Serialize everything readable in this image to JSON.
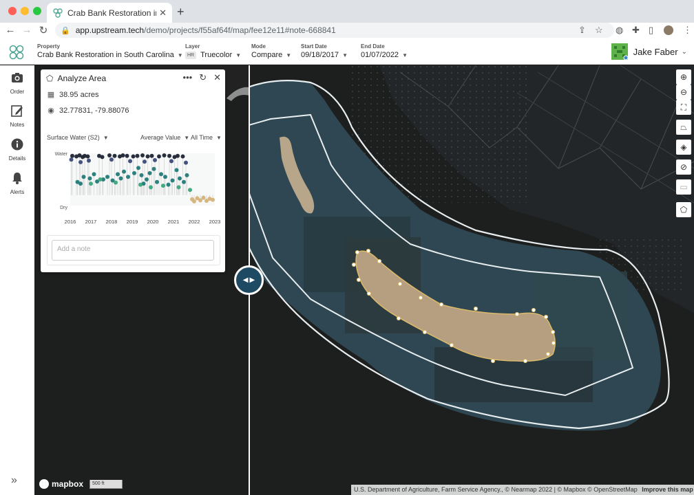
{
  "browser": {
    "tab_title": "Crab Bank Restoration in South",
    "url_host": "app.upstream.tech",
    "url_path": "/demo/projects/f55af64f/map/fee12e11#note-668841"
  },
  "header": {
    "property_label": "Property",
    "property_value": "Crab Bank Restoration in South Carolina",
    "layer_label": "Layer",
    "layer_badge": "HR",
    "layer_value": "Truecolor",
    "mode_label": "Mode",
    "mode_value": "Compare",
    "start_label": "Start Date",
    "start_value": "09/18/2017",
    "end_label": "End Date",
    "end_value": "01/07/2022",
    "user_name": "Jake Faber"
  },
  "rail": {
    "items": [
      {
        "label": "Order",
        "icon": "camera-icon"
      },
      {
        "label": "Notes",
        "icon": "edit-icon"
      },
      {
        "label": "Details",
        "icon": "info-icon"
      },
      {
        "label": "Alerts",
        "icon": "bell-icon"
      }
    ]
  },
  "panel": {
    "title": "Analyze Area",
    "area": "38.95 acres",
    "coords": "32.77831, -79.88076",
    "metric": "Surface Water (S2)",
    "aggregation": "Average Value",
    "range": "All Time",
    "note_placeholder": "Add a note"
  },
  "chart_data": {
    "type": "scatter",
    "title": "",
    "xlabel": "",
    "ylabel": "",
    "y_top_label": "Water",
    "y_bottom_label": "Dry",
    "x_ticks": [
      "2016",
      "2017",
      "2018",
      "2019",
      "2020",
      "2021",
      "2022",
      "2023"
    ],
    "xlim": [
      2016,
      2023
    ],
    "ylim": [
      0,
      1
    ],
    "series": [
      {
        "color": "#1f2433",
        "points": [
          [
            2016.1,
            0.95
          ],
          [
            2016.3,
            0.94
          ],
          [
            2016.45,
            0.96
          ],
          [
            2016.6,
            0.93
          ],
          [
            2016.7,
            0.95
          ],
          [
            2016.85,
            0.94
          ],
          [
            2017.4,
            0.95
          ],
          [
            2017.55,
            0.93
          ],
          [
            2017.9,
            0.96
          ],
          [
            2018.15,
            0.95
          ],
          [
            2018.4,
            0.94
          ],
          [
            2018.55,
            0.96
          ],
          [
            2018.75,
            0.95
          ],
          [
            2019.05,
            0.94
          ],
          [
            2019.25,
            0.95
          ],
          [
            2019.5,
            0.96
          ],
          [
            2019.75,
            0.94
          ],
          [
            2019.95,
            0.95
          ],
          [
            2020.3,
            0.94
          ],
          [
            2020.55,
            0.96
          ],
          [
            2020.8,
            0.95
          ],
          [
            2021.05,
            0.93
          ],
          [
            2021.2,
            0.95
          ],
          [
            2021.45,
            0.94
          ]
        ]
      },
      {
        "color": "#3b4a7a",
        "points": [
          [
            2016.05,
            0.88
          ],
          [
            2016.5,
            0.83
          ],
          [
            2016.9,
            0.86
          ],
          [
            2018.0,
            0.88
          ],
          [
            2018.9,
            0.85
          ],
          [
            2019.6,
            0.84
          ],
          [
            2020.1,
            0.87
          ],
          [
            2020.9,
            0.85
          ],
          [
            2021.6,
            0.82
          ]
        ]
      },
      {
        "color": "#227a78",
        "points": [
          [
            2016.35,
            0.45
          ],
          [
            2016.5,
            0.42
          ],
          [
            2016.65,
            0.55
          ],
          [
            2016.95,
            0.52
          ],
          [
            2017.15,
            0.6
          ],
          [
            2017.3,
            0.46
          ],
          [
            2017.6,
            0.5
          ],
          [
            2017.8,
            0.55
          ],
          [
            2018.05,
            0.48
          ],
          [
            2018.3,
            0.6
          ],
          [
            2018.45,
            0.52
          ],
          [
            2018.6,
            0.65
          ],
          [
            2018.8,
            0.55
          ],
          [
            2019.1,
            0.62
          ],
          [
            2019.3,
            0.72
          ],
          [
            2019.45,
            0.58
          ],
          [
            2019.55,
            0.42
          ],
          [
            2019.7,
            0.5
          ],
          [
            2019.85,
            0.62
          ],
          [
            2020.05,
            0.7
          ],
          [
            2020.2,
            0.45
          ],
          [
            2020.4,
            0.6
          ],
          [
            2020.6,
            0.55
          ],
          [
            2020.75,
            0.4
          ],
          [
            2020.95,
            0.48
          ],
          [
            2021.15,
            0.68
          ],
          [
            2021.3,
            0.52
          ],
          [
            2021.5,
            0.45
          ],
          [
            2021.65,
            0.58
          ]
        ]
      },
      {
        "color": "#39a77a",
        "points": [
          [
            2017.0,
            0.42
          ],
          [
            2017.45,
            0.5
          ],
          [
            2018.2,
            0.44
          ],
          [
            2019.4,
            0.4
          ],
          [
            2019.9,
            0.35
          ],
          [
            2020.5,
            0.38
          ],
          [
            2021.25,
            0.35
          ],
          [
            2021.8,
            0.3
          ]
        ]
      },
      {
        "color": "#d4b37a",
        "points": [
          [
            2021.9,
            0.12
          ],
          [
            2022.0,
            0.08
          ],
          [
            2022.15,
            0.14
          ],
          [
            2022.3,
            0.1
          ],
          [
            2022.45,
            0.15
          ],
          [
            2022.6,
            0.09
          ],
          [
            2022.75,
            0.13
          ],
          [
            2022.9,
            0.11
          ]
        ]
      }
    ]
  },
  "map": {
    "attribution": "U.S. Department of Agriculture, Farm Service Agency., © Nearmap 2022 | © Mapbox © OpenStreetMap",
    "attribution_link": "Improve this map",
    "brand": "mapbox",
    "scale_label": "500 ft"
  }
}
